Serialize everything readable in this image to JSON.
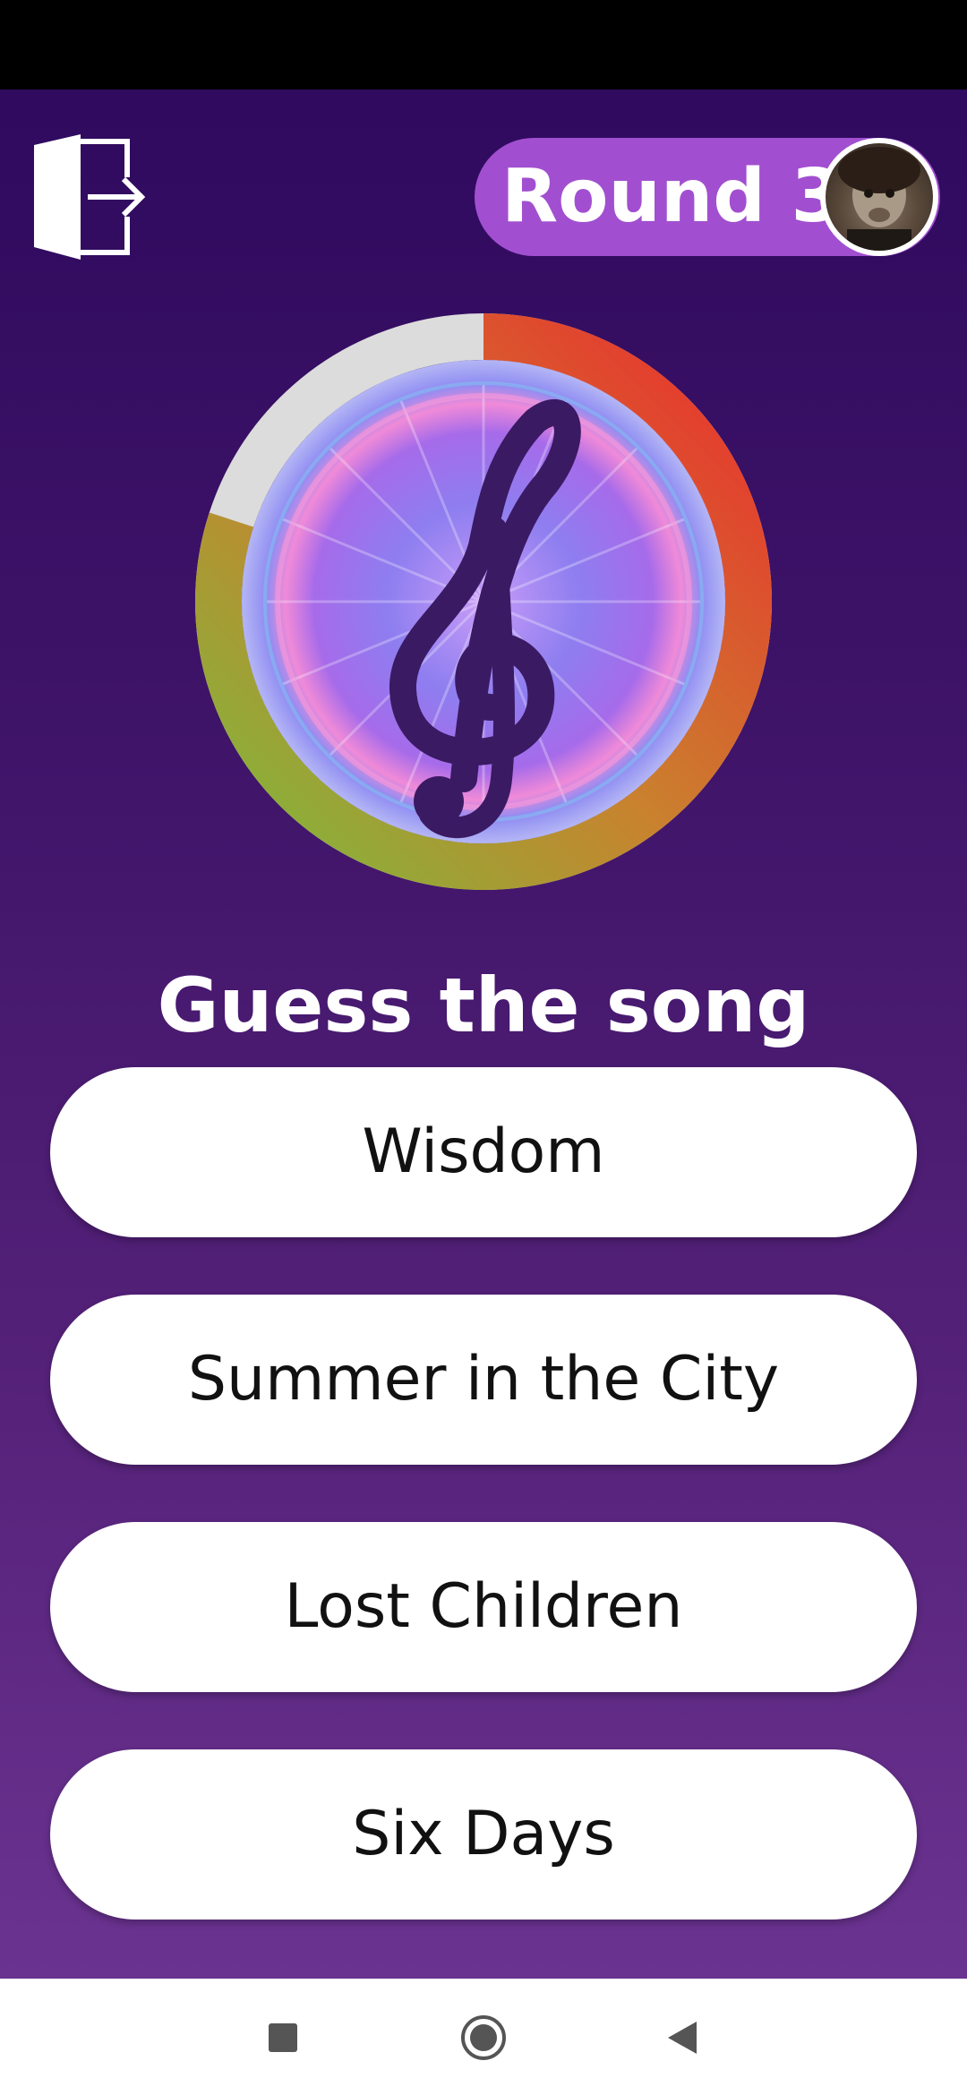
{
  "header": {
    "round_label": "Round 3"
  },
  "timer": {
    "remaining_fraction": 0.8,
    "colors": {
      "start": "#ea2e2e",
      "middle": "#c9822e",
      "end": "#7bbb3c",
      "track": "#dcdcdc",
      "icon": "#3a1a63"
    },
    "icon": "treble-clef-icon"
  },
  "question": {
    "title": "Guess the song"
  },
  "answers": [
    {
      "label": "Wisdom"
    },
    {
      "label": "Summer in the City"
    },
    {
      "label": "Lost Children"
    },
    {
      "label": "Six Days"
    }
  ],
  "nav": {
    "icons": [
      "recents-square-icon",
      "home-circle-icon",
      "back-triangle-icon"
    ]
  }
}
